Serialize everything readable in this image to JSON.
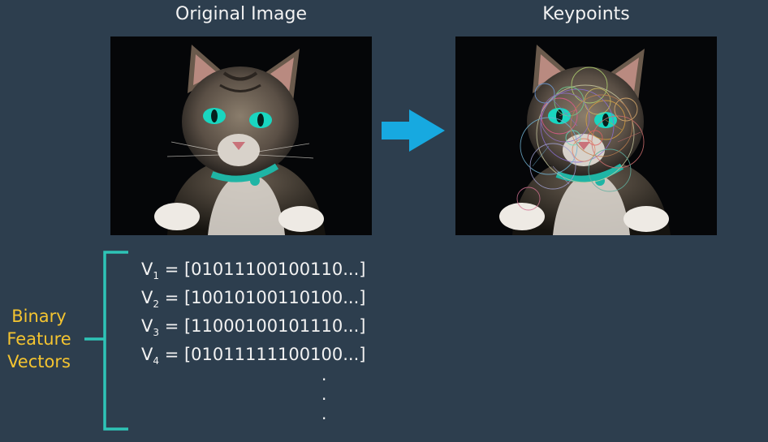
{
  "titles": {
    "left": "Original Image",
    "right": "Keypoints"
  },
  "label": {
    "line1": "Binary",
    "line2": "Feature",
    "line3": "Vectors"
  },
  "vectors": [
    {
      "sym": "V",
      "sub": "1",
      "value": "= [01011100100110...]"
    },
    {
      "sym": "V",
      "sub": "2",
      "value": "= [10010100110100...]"
    },
    {
      "sym": "V",
      "sub": "3",
      "value": "= [11000100101110...]"
    },
    {
      "sym": "V",
      "sub": "4",
      "value": "= [01011111100100...]"
    }
  ],
  "ellipsis": [
    ".",
    ".",
    "."
  ],
  "colors": {
    "background": "#2d3e4e",
    "label": "#f4c430",
    "bracket": "#2ec4b6",
    "arrow": "#17a9e0",
    "cat_eye": "#19d6c0"
  },
  "icons": {
    "arrow": "right-arrow-icon",
    "bracket": "left-bracket-icon"
  }
}
